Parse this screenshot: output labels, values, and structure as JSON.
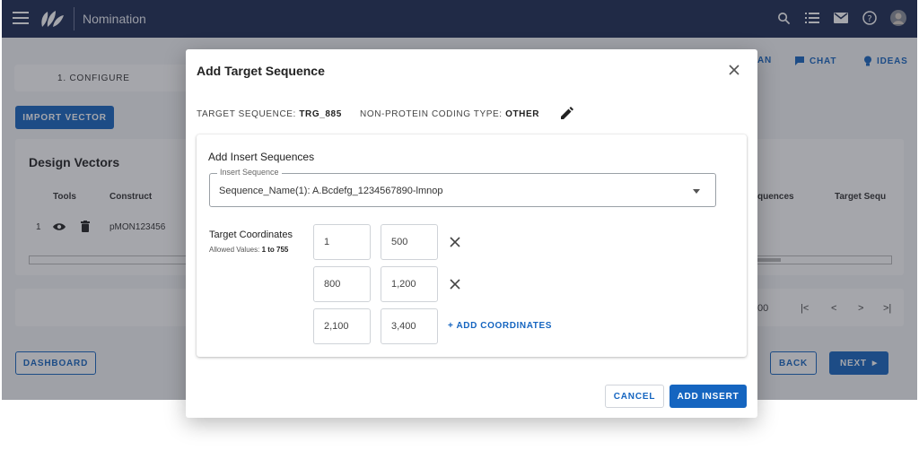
{
  "app": {
    "title": "Nomination",
    "top_icons": [
      "search-icon",
      "list-icon",
      "mail-icon",
      "help-icon",
      "avatar"
    ]
  },
  "background": {
    "step_tab": "1. CONFIGURE",
    "import_button": "IMPORT VECTOR",
    "card_title": "Design Vectors",
    "table_headers": {
      "num": "",
      "tools": "Tools",
      "construct": "Construct",
      "sequences": "quences",
      "target_seq": "Target Sequ"
    },
    "rows": [
      {
        "num": "1",
        "construct": "pMON123456"
      }
    ],
    "right_tabs": {
      "plan": "AN",
      "chat": "CHAT",
      "ideas": "IDEAS"
    },
    "pager": {
      "count": "00"
    },
    "dashboard_button": "DASHBOARD",
    "back_button": "BACK",
    "next_button": "NEXT"
  },
  "dialog": {
    "title": "Add Target Sequence",
    "target_sequence_label": "TARGET SEQUENCE:",
    "target_sequence_value": "TRG_885",
    "coding_type_label": "NON-PROTEIN CODING TYPE:",
    "coding_type_value": "OTHER",
    "section_title": "Add Insert Sequences",
    "insert_sequence_label": "Insert Sequence",
    "insert_sequence_value": "Sequence_Name(1): A.Bcdefg_1234567890-lmnop",
    "target_coordinates_label": "Target Coordinates",
    "allowed_values_label": "Allowed Values:",
    "allowed_values_range": "1 to 755",
    "coordinates": [
      {
        "start": "1",
        "end": "500"
      },
      {
        "start": "800",
        "end": "1,200"
      },
      {
        "start": "2,100",
        "end": "3,400"
      }
    ],
    "add_coordinates_label": "+ ADD COORDINATES",
    "cancel_label": "CANCEL",
    "add_insert_label": "ADD INSERT"
  },
  "colors": {
    "primary": "#1565c0",
    "topbar": "#1b2a52"
  }
}
